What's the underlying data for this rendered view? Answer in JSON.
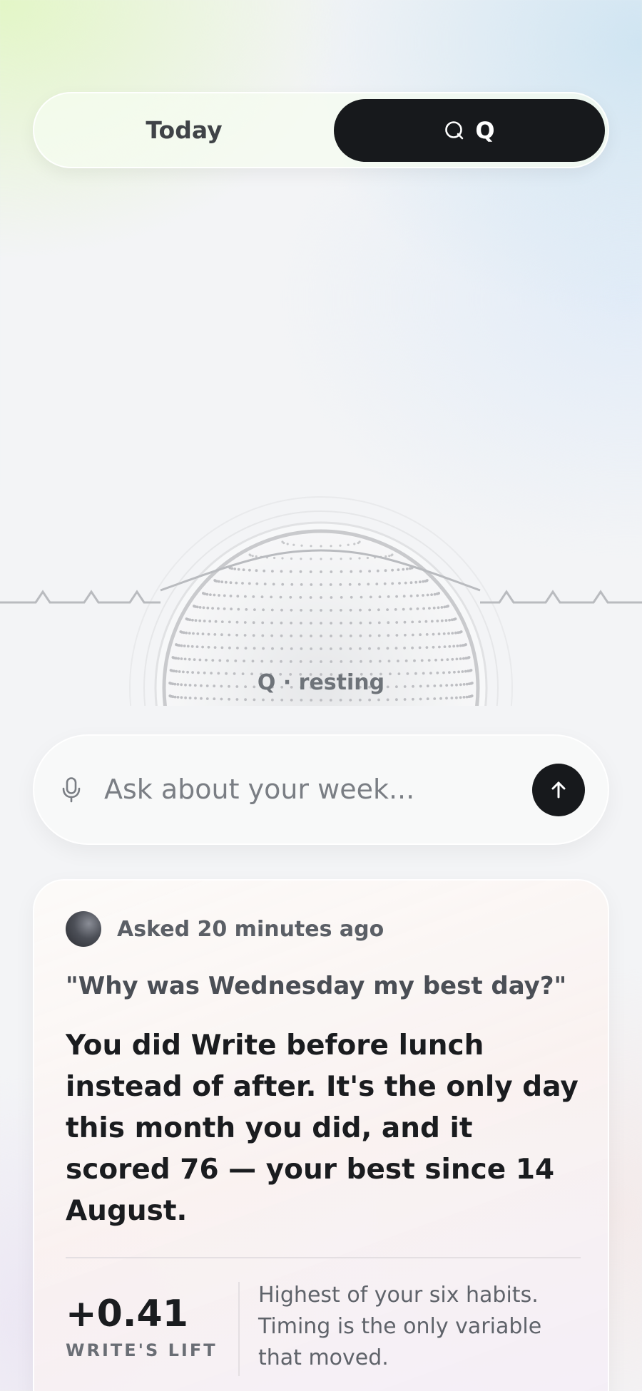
{
  "segmented": {
    "today_label": "Today",
    "q_label": "Q"
  },
  "orb": {
    "status": "Q · resting"
  },
  "ask": {
    "placeholder": "Ask about your week..."
  },
  "card": {
    "asked": "Asked 20 minutes ago",
    "question": "\"Why was Wednesday my best day?\"",
    "answer": "You did Write before lunch instead of after. It's the only day this month you did, and it scored 76 — your best since 14 August.",
    "stat_value": "+0.41",
    "stat_label": "WRITE'S LIFT",
    "stat_note": "Highest of your six habits. Timing is the only variable that moved."
  },
  "icons": {
    "q_tab": "q-search-icon",
    "mic": "mic-icon",
    "send": "arrow-up-icon"
  }
}
